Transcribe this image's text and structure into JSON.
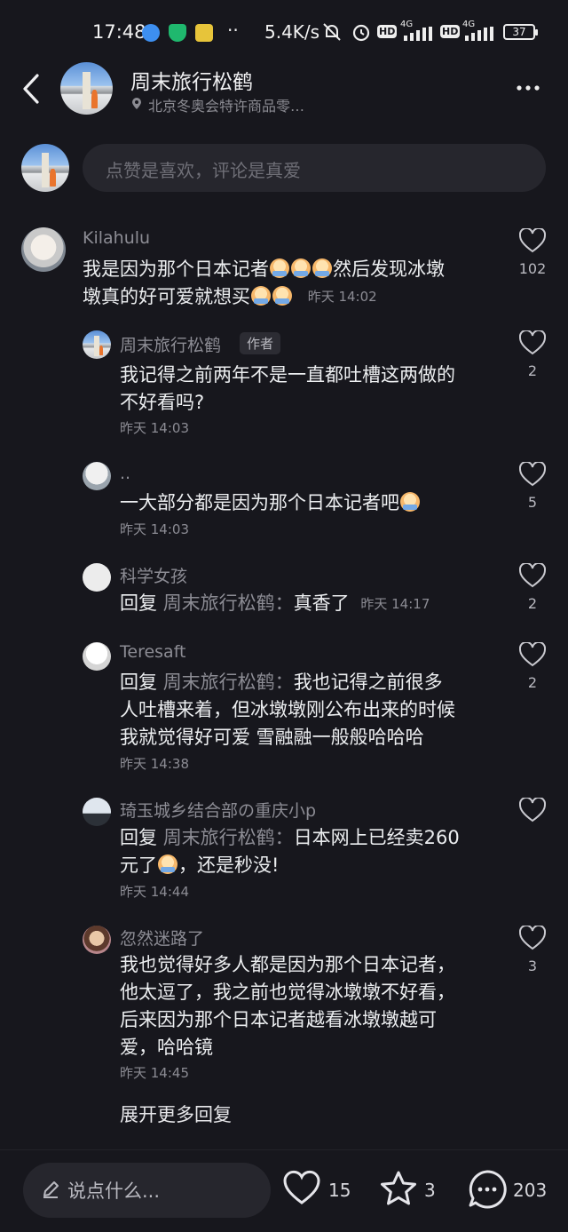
{
  "status_bar": {
    "time": "17:48",
    "network_speed": "5.4K/s",
    "battery": "37",
    "signal1": "4G",
    "signal2": "4G",
    "hd1": "HD",
    "hd2": "HD"
  },
  "header": {
    "title": "周末旅行松鹤",
    "location": "北京冬奥会特许商品零…"
  },
  "comment_input": {
    "placeholder": "点赞是喜欢，评论是真爱"
  },
  "comments": [
    {
      "user": "Kilahulu",
      "text_line1": "我是因为那个日本记者",
      "text_after_emoji": "然后发现冰墩",
      "text_line2": "墩真的好可爱就想买",
      "time": "昨天 14:02",
      "likes": "102"
    },
    {
      "user": "周末旅行松鹤",
      "author_tag": "作者",
      "text_line1": "我记得之前两年不是一直都吐槽这两做的",
      "text_line2": "不好看吗?",
      "time": "昨天 14:03",
      "likes": "2"
    },
    {
      "user": "..",
      "text_line1": "一大部分都是因为那个日本记者吧",
      "time": "昨天 14:03",
      "likes": "5"
    },
    {
      "user": "科学女孩",
      "reply_prefix": "回复",
      "reply_target": "周末旅行松鹤：",
      "text_line1": "真香了",
      "time": "昨天 14:17",
      "likes": "2"
    },
    {
      "user": "Teresaft",
      "reply_prefix": "回复",
      "reply_target": "周末旅行松鹤：",
      "text_line1": "我也记得之前很多",
      "text_line2": "人吐槽来着，但冰墩墩刚公布出来的时候",
      "text_line3": "我就觉得好可爱 雪融融一般般哈哈哈",
      "time": "昨天 14:38",
      "likes": "2"
    },
    {
      "user": "琦玉城乡结合部の重庆小p",
      "reply_prefix": "回复",
      "reply_target": "周末旅行松鹤：",
      "text_line1": "日本网上已经卖260",
      "text_line2a": "元了",
      "text_line2b": "，还是秒没!",
      "time": "昨天 14:44"
    },
    {
      "user": "忽然迷路了",
      "text_line1": "我也觉得好多人都是因为那个日本记者，",
      "text_line2": "他太逗了，我之前也觉得冰墩墩不好看，",
      "text_line3": "后来因为那个日本记者越看冰墩墩越可",
      "text_line4": "爱，哈哈镜",
      "time": "昨天 14:45",
      "likes": "3"
    }
  ],
  "expand_more": "展开更多回复",
  "bottom_bar": {
    "input_placeholder": "说点什么...",
    "like_count": "15",
    "star_count": "3",
    "comment_count": "203"
  }
}
